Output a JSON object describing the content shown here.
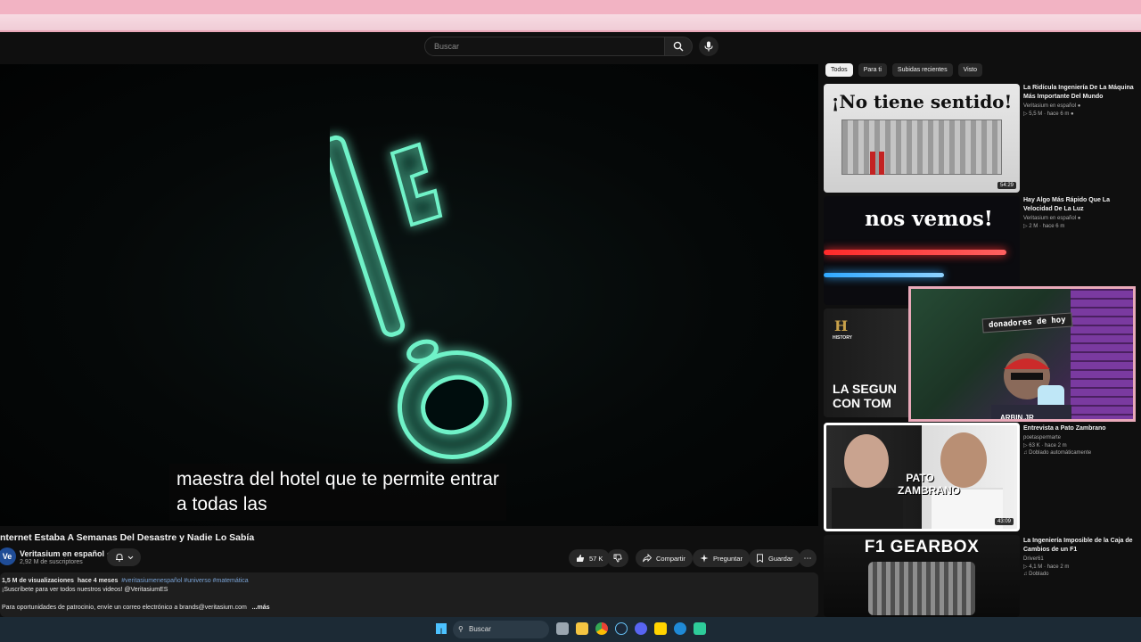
{
  "search": {
    "placeholder": "Buscar"
  },
  "player": {
    "caption_lines": [
      "maestra del hotel que te permite entrar",
      "a todas las"
    ]
  },
  "video": {
    "title": "nternet Estaba A Semanas Del Desastre y Nadie Lo Sabía",
    "channel": {
      "avatar_text": "Ve",
      "name": "Veritasium en español",
      "subscribers": "2,92 M de suscriptores"
    },
    "actions": {
      "likes": "57 K",
      "share": "Compartir",
      "ask": "Preguntar",
      "save": "Guardar"
    },
    "description": {
      "views": "1,5 M de visualizaciones",
      "date": "hace 4 meses",
      "tags": "#veritasiumenespañol #universo #matemática",
      "line2": "¡Suscríbete para ver todos nuestros videos! @VeritasiumES",
      "line3": "Para oportunidades de patrocinio, envíe un correo electrónico a brands@veritasium.com",
      "more": "...más"
    }
  },
  "chips": [
    "Todos",
    "Para ti",
    "Subidas recientes",
    "Visto"
  ],
  "recommendations": [
    {
      "title": "La Ridícula Ingeniería De La Máquina Más Importante Del Mundo",
      "channel": "Veritasium en español",
      "stats": "5,5 M · hace 6 m",
      "thumb_text": "¡No tiene sentido!",
      "duration": "54:29",
      "badge": ""
    },
    {
      "title": "Hay Algo Más Rápido Que La Velocidad De La Luz",
      "channel": "Veritasium en español",
      "stats": "2 M · hace 6 m",
      "thumb_text": "nos vemos!",
      "duration": "",
      "badge": ""
    },
    {
      "title": "",
      "channel": "",
      "stats": "",
      "thumb_text": "LA SEGUN CON TOM",
      "thumb_logo": "H",
      "thumb_logo_sub": "HISTORY",
      "duration": "",
      "badge": ""
    },
    {
      "title": "Entrevista a Pato Zambrano",
      "channel": "poetaspermarte",
      "stats": "63 K · hace 2 m",
      "thumb_text": "PATO ZAMBRANO",
      "duration": "43:09",
      "badge": "Doblado automáticamente"
    },
    {
      "title": "La Ingeniería Imposible de la Caja de Cambios de un F1",
      "channel": "Driver61",
      "stats": "4,1 M · hace 2 m",
      "thumb_text": "F1 GEARBOX",
      "duration": "",
      "badge": "Doblado"
    }
  ],
  "webcam": {
    "banner": "donadores de hoy",
    "bottom_text": "ARBIN.JR"
  },
  "taskbar": {
    "search_label": "Buscar"
  },
  "colors": {
    "accent_red": "#ff0000",
    "caption_bg": "#080808",
    "link": "#7aa3d6",
    "pink_frame": "#e9a9b9"
  }
}
